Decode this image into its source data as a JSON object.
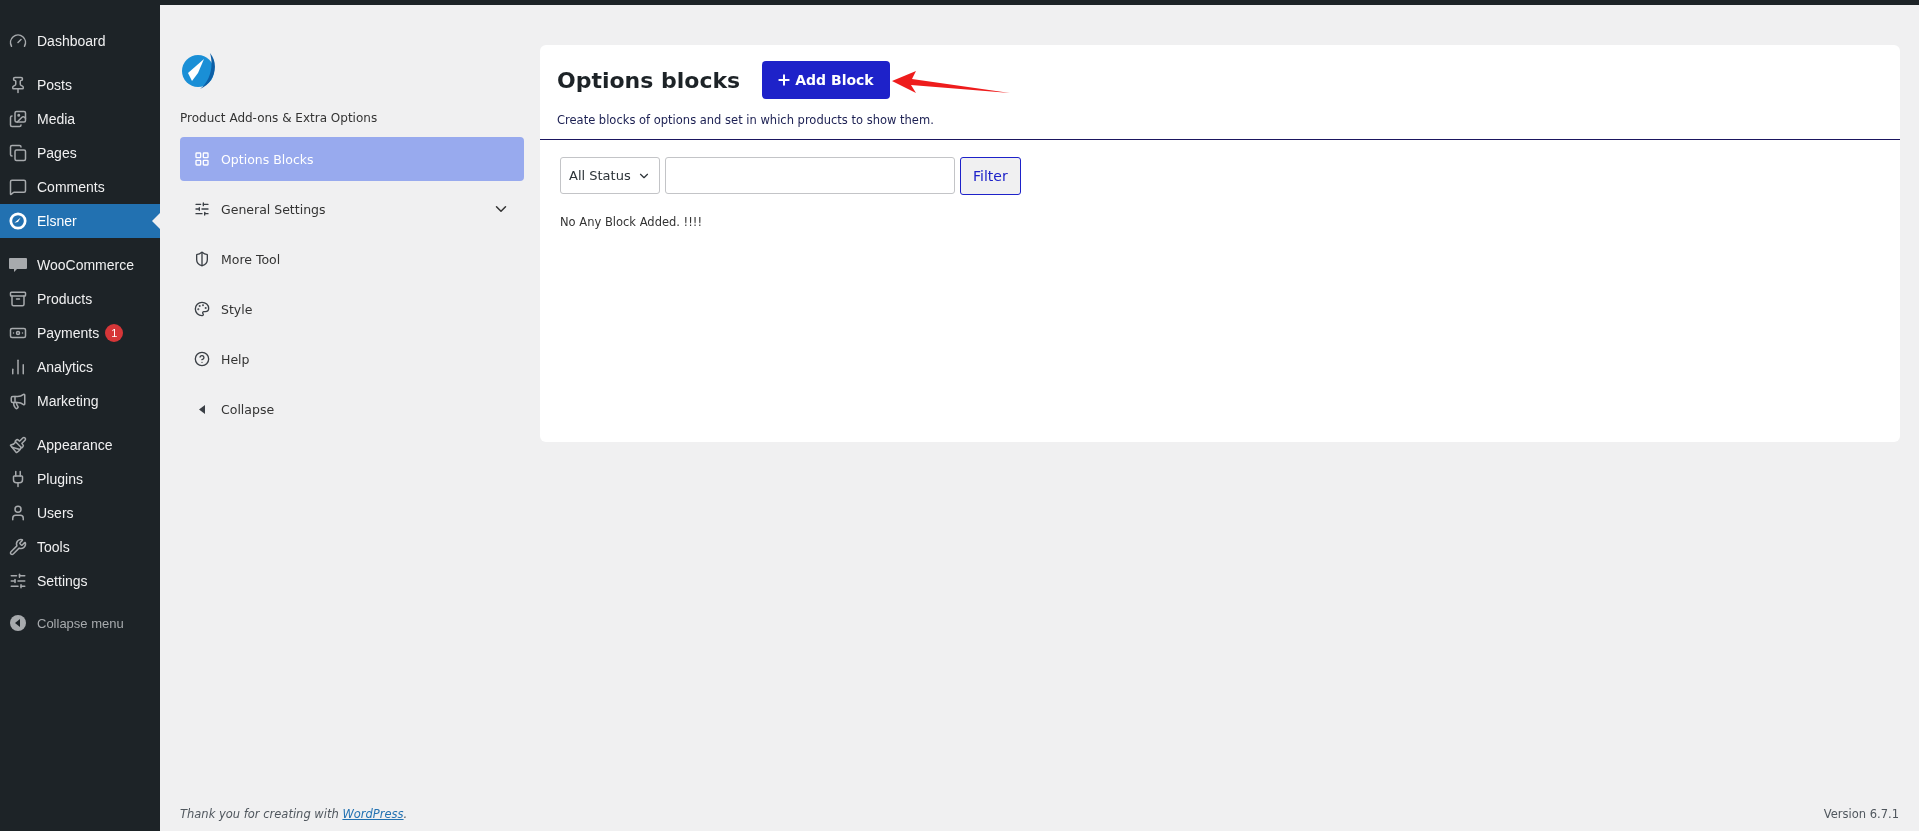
{
  "admin_menu": {
    "groups": [
      [
        {
          "label": "Dashboard",
          "selected": false
        }
      ],
      [
        {
          "label": "Posts",
          "selected": false
        },
        {
          "label": "Media",
          "selected": false
        },
        {
          "label": "Pages",
          "selected": false
        },
        {
          "label": "Comments",
          "selected": false
        },
        {
          "label": "Elsner",
          "selected": true
        }
      ],
      [
        {
          "label": "WooCommerce",
          "selected": false
        },
        {
          "label": "Products",
          "selected": false
        },
        {
          "label": "Payments",
          "selected": false,
          "badge": "1"
        },
        {
          "label": "Analytics",
          "selected": false
        },
        {
          "label": "Marketing",
          "selected": false
        }
      ],
      [
        {
          "label": "Appearance",
          "selected": false
        },
        {
          "label": "Plugins",
          "selected": false
        },
        {
          "label": "Users",
          "selected": false
        },
        {
          "label": "Tools",
          "selected": false
        },
        {
          "label": "Settings",
          "selected": false
        }
      ]
    ],
    "collapse": "Collapse menu"
  },
  "plugin_nav": {
    "title": "Product Add-ons & Extra Options",
    "items": [
      {
        "label": "Options Blocks",
        "selected": true
      },
      {
        "label": "General Settings",
        "selected": false,
        "expandable": true
      },
      {
        "label": "More Tool",
        "selected": false
      },
      {
        "label": "Style",
        "selected": false
      },
      {
        "label": "Help",
        "selected": false
      },
      {
        "label": "Collapse",
        "selected": false
      }
    ]
  },
  "card": {
    "title": "Options blocks",
    "add_button": "Add Block",
    "description": "Create blocks of options and set in which products to show them.",
    "status_select": "All Status",
    "filter_button": "Filter",
    "empty_message": "No Any Block Added. !!!!"
  },
  "footer": {
    "thanks": "Thank you for creating with ",
    "link": "WordPress",
    "after_link": ".",
    "version": "Version 6.7.1"
  }
}
